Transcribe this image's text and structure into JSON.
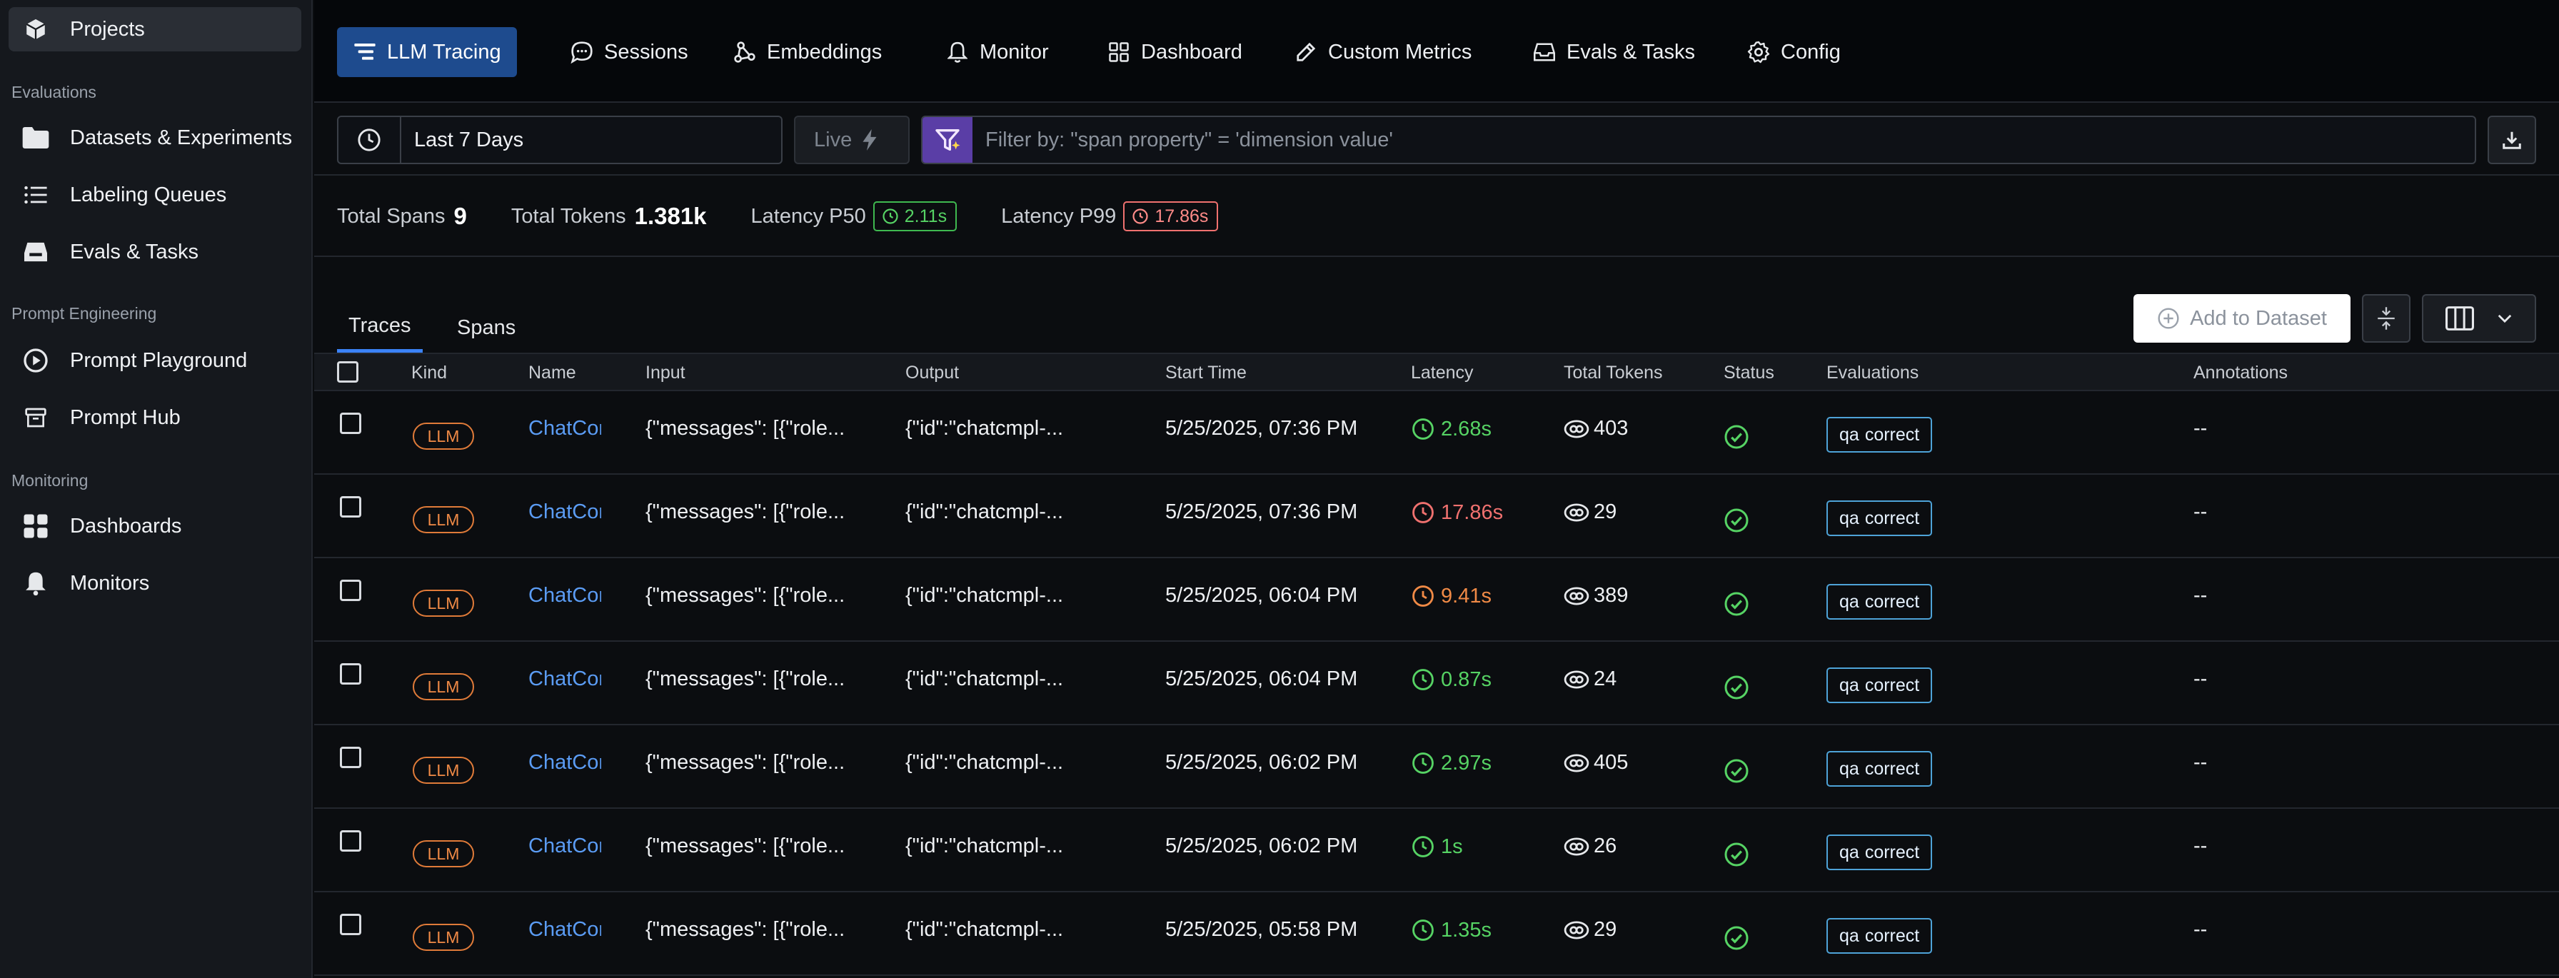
{
  "sidebar": {
    "top_item": {
      "label": "Projects",
      "icon": "cube-icon"
    },
    "sections": [
      {
        "label": "Evaluations"
      },
      {
        "label": "Prompt Engineering"
      },
      {
        "label": "Monitoring"
      }
    ],
    "items": [
      {
        "label": "Datasets & Experiments",
        "icon": "folder-icon"
      },
      {
        "label": "Labeling Queues",
        "icon": "list-icon"
      },
      {
        "label": "Evals & Tasks",
        "icon": "inbox-icon"
      },
      {
        "label": "Prompt Playground",
        "icon": "play-icon"
      },
      {
        "label": "Prompt Hub",
        "icon": "archive-icon"
      },
      {
        "label": "Dashboards",
        "icon": "grid-icon"
      },
      {
        "label": "Monitors",
        "icon": "bell-icon"
      }
    ]
  },
  "topnav": {
    "tabs": [
      {
        "label": "LLM Tracing",
        "icon": "tracing-icon",
        "active": true
      },
      {
        "label": "Sessions",
        "icon": "chat-icon"
      },
      {
        "label": "Embeddings",
        "icon": "embeddings-icon"
      },
      {
        "label": "Monitor",
        "icon": "bell-icon"
      },
      {
        "label": "Dashboard",
        "icon": "grid-icon"
      },
      {
        "label": "Custom Metrics",
        "icon": "pen-icon"
      },
      {
        "label": "Evals & Tasks",
        "icon": "inbox-icon"
      },
      {
        "label": "Config",
        "icon": "gear-icon"
      }
    ]
  },
  "filters": {
    "time_range": "Last 7 Days",
    "live_label": "Live",
    "filter_placeholder": "Filter by: \"span property\" = 'dimension value'"
  },
  "stats": {
    "total_spans_label": "Total Spans",
    "total_spans_value": "9",
    "total_tokens_label": "Total Tokens",
    "total_tokens_value": "1.381k",
    "latency_p50_label": "Latency P50",
    "latency_p50_value": "2.11s",
    "latency_p99_label": "Latency P99",
    "latency_p99_value": "17.86s"
  },
  "content_tabs": [
    {
      "label": "Traces",
      "active": true
    },
    {
      "label": "Spans"
    }
  ],
  "toolbar": {
    "add_to_dataset": "Add to Dataset"
  },
  "table": {
    "columns": [
      "Kind",
      "Name",
      "Input",
      "Output",
      "Start Time",
      "Latency",
      "Total Tokens",
      "Status",
      "Evaluations",
      "Annotations"
    ],
    "rows": [
      {
        "kind": "LLM",
        "name": "ChatCompletion",
        "input": "{\"messages\": [{\"role...",
        "output": "{\"id\":\"chatcmpl-...",
        "start_time": "5/25/2025, 07:36 PM",
        "latency": "2.68s",
        "latency_level": "good",
        "tokens": "403",
        "evaluation": "qa",
        "eval_label": "correct",
        "annotations": "--"
      },
      {
        "kind": "LLM",
        "name": "ChatCompletion",
        "input": "{\"messages\": [{\"role...",
        "output": "{\"id\":\"chatcmpl-...",
        "start_time": "5/25/2025, 07:36 PM",
        "latency": "17.86s",
        "latency_level": "bad",
        "tokens": "29",
        "evaluation": "qa",
        "eval_label": "correct",
        "annotations": "--"
      },
      {
        "kind": "LLM",
        "name": "ChatCompletion",
        "input": "{\"messages\": [{\"role...",
        "output": "{\"id\":\"chatcmpl-...",
        "start_time": "5/25/2025, 06:04 PM",
        "latency": "9.41s",
        "latency_level": "warn",
        "tokens": "389",
        "evaluation": "qa",
        "eval_label": "correct",
        "annotations": "--"
      },
      {
        "kind": "LLM",
        "name": "ChatCompletion",
        "input": "{\"messages\": [{\"role...",
        "output": "{\"id\":\"chatcmpl-...",
        "start_time": "5/25/2025, 06:04 PM",
        "latency": "0.87s",
        "latency_level": "good",
        "tokens": "24",
        "evaluation": "qa",
        "eval_label": "correct",
        "annotations": "--"
      },
      {
        "kind": "LLM",
        "name": "ChatCompletion",
        "input": "{\"messages\": [{\"role...",
        "output": "{\"id\":\"chatcmpl-...",
        "start_time": "5/25/2025, 06:02 PM",
        "latency": "2.97s",
        "latency_level": "good",
        "tokens": "405",
        "evaluation": "qa",
        "eval_label": "correct",
        "annotations": "--"
      },
      {
        "kind": "LLM",
        "name": "ChatCompletion",
        "input": "{\"messages\": [{\"role...",
        "output": "{\"id\":\"chatcmpl-...",
        "start_time": "5/25/2025, 06:02 PM",
        "latency": "1s",
        "latency_level": "good",
        "tokens": "26",
        "evaluation": "qa",
        "eval_label": "correct",
        "annotations": "--"
      },
      {
        "kind": "LLM",
        "name": "ChatCompletion",
        "input": "{\"messages\": [{\"role...",
        "output": "{\"id\":\"chatcmpl-...",
        "start_time": "5/25/2025, 05:58 PM",
        "latency": "1.35s",
        "latency_level": "good",
        "tokens": "29",
        "evaluation": "qa",
        "eval_label": "correct",
        "annotations": "--"
      }
    ]
  },
  "colors": {
    "accent": "#1e4b8e",
    "link": "#5b9cf4",
    "good": "#56d364",
    "warn": "#f08a46",
    "bad": "#f0716f"
  }
}
